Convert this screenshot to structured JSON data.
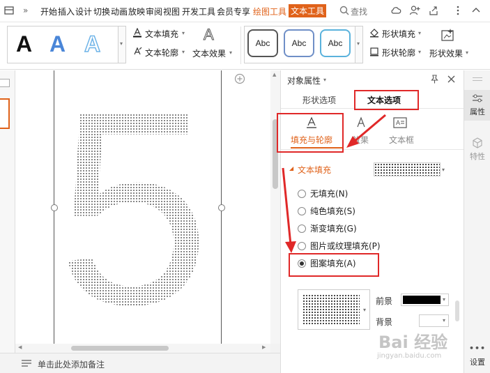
{
  "menubar": {
    "items": [
      "开始",
      "插入",
      "设计",
      "切换",
      "动画",
      "放映",
      "审阅",
      "视图",
      "开发工具",
      "会员专享",
      "绘图工具",
      "文本工具"
    ],
    "search_label": "查找"
  },
  "ribbon": {
    "text_fill": "文本填充",
    "text_outline": "文本轮廓",
    "text_effects": "文本效果",
    "shape_fill": "形状填充",
    "shape_outline": "形状轮廓",
    "shape_effects": "形状效果",
    "art_glyph": "A",
    "abc_label": "Abc",
    "colors": {
      "accent": "#e0621a",
      "art_blue": "#4a86d8",
      "art_light_blue": "#6fb4e8"
    }
  },
  "canvas": {
    "digit": "5",
    "status_note": "单击此处添加备注"
  },
  "panel": {
    "title": "对象属性",
    "tabs": [
      "形状选项",
      "文本选项"
    ],
    "active_tab": "文本选项",
    "subtabs": [
      "填充与轮廓",
      "效果",
      "文本框"
    ],
    "active_subtab": "填充与轮廓",
    "section_title": "文本填充",
    "options": [
      {
        "label": "无填充(N)",
        "checked": false
      },
      {
        "label": "纯色填充(S)",
        "checked": false
      },
      {
        "label": "渐变填充(G)",
        "checked": false
      },
      {
        "label": "图片或纹理填充(P)",
        "checked": false
      },
      {
        "label": "图案填充(A)",
        "checked": true
      }
    ],
    "foreground_label": "前景",
    "background_label": "背景",
    "foreground_color": "#000000",
    "background_color": "#ffffff"
  },
  "sidebar": {
    "properties": "属性",
    "features": "特性",
    "settings": "设置"
  },
  "watermark": {
    "brand": "Bai  经验",
    "site": "jingyan.baidu.com"
  }
}
